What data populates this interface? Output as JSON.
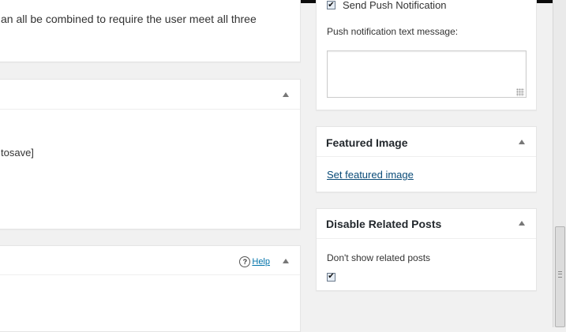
{
  "left_column": {
    "top_box": {
      "text": "an all be combined to require the user meet all three"
    },
    "middle_box": {
      "text": "tosave]"
    },
    "bottom_box": {
      "help_icon": "question-circle-icon",
      "help_label": "Help"
    }
  },
  "push_box": {
    "checkbox_label": "Send Push Notification",
    "checkbox_checked": true,
    "textarea_label": "Push notification text message:",
    "textarea_value": ""
  },
  "featured_image": {
    "title": "Featured Image",
    "link_label": "Set featured image"
  },
  "disable_related_posts": {
    "title": "Disable Related Posts",
    "description": "Don't show related posts",
    "checkbox_checked": true
  },
  "icons": {
    "toggle": "triangle-up-icon",
    "check": "checkmark-icon"
  },
  "colors": {
    "link": "#0073aa",
    "background": "#f1f1f1"
  }
}
